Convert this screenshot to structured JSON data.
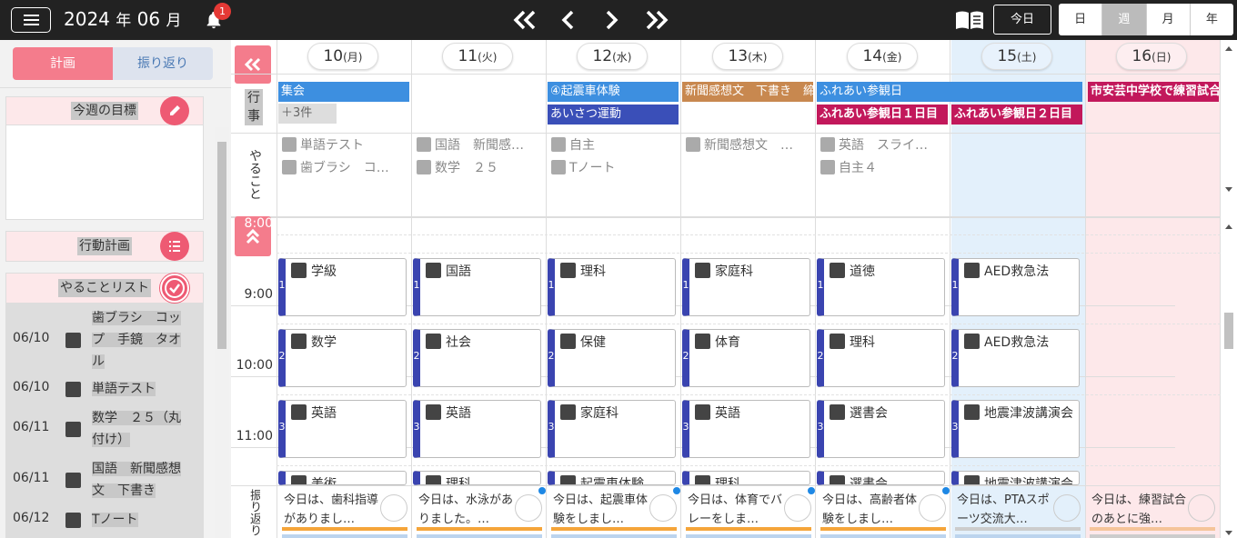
{
  "header": {
    "year": "2024",
    "year_suffix": "年",
    "month": "06",
    "month_suffix": "月",
    "notification_count": "1",
    "today_label": "今日",
    "views": [
      "日",
      "週",
      "月",
      "年"
    ],
    "active_view": "週"
  },
  "sidebar": {
    "tabs": {
      "plan": "計画",
      "review": "振り返り"
    },
    "goal_title": "今週の目標",
    "action_plan_title": "行動計画",
    "todo_title": "やることリスト",
    "todos": [
      {
        "date": "06/10",
        "text": "歯ブラシ　コップ　手鏡　タオル"
      },
      {
        "date": "06/10",
        "text": "単語テスト"
      },
      {
        "date": "06/11",
        "text": "数学　２５（丸付け）"
      },
      {
        "date": "06/11",
        "text": "国語　新聞感想文　下書き"
      },
      {
        "date": "06/12",
        "text": "Tノート"
      }
    ]
  },
  "days": [
    {
      "num": "10",
      "dow": "(月)"
    },
    {
      "num": "11",
      "dow": "(火)"
    },
    {
      "num": "12",
      "dow": "(水)"
    },
    {
      "num": "13",
      "dow": "(木)"
    },
    {
      "num": "14",
      "dow": "(金)"
    },
    {
      "num": "15",
      "dow": "(土)"
    },
    {
      "num": "16",
      "dow": "(日)"
    }
  ],
  "row_labels": {
    "events_1": "行",
    "events_2": "事",
    "todo": "やること",
    "review": "振り返り"
  },
  "events": [
    {
      "text": "集会",
      "color": "#3d8fe0"
    },
    {
      "text": "＋3件",
      "color": "#ddd"
    },
    {
      "text": "④起震車体験",
      "color": "#3d8fe0"
    },
    {
      "text": "あいさつ運動",
      "color": "#3a4fb8"
    },
    {
      "text": "新聞感想文　下書き　締",
      "color": "#c8884f"
    },
    {
      "text": "ふれあい参観日",
      "color": "#3d8fe0"
    },
    {
      "text": "ふれあい参観日１日目",
      "color": "#c2185b"
    },
    {
      "text": "ふれあい参観日２日目",
      "color": "#c2185b"
    },
    {
      "text": "市安芸中学校で練習試合",
      "color": "#c2185b"
    }
  ],
  "day_todos": [
    [
      "単語テスト",
      "歯ブラシ　コ…"
    ],
    [
      "国語　新聞感…",
      "数学　２５"
    ],
    [
      "自主",
      "Tノート"
    ],
    [
      "新聞感想文　…"
    ],
    [
      "英語　スライ…",
      "自主４"
    ],
    [],
    []
  ],
  "times": [
    "8:00",
    "9:00",
    "10:00",
    "11:00"
  ],
  "periods": [
    [
      "学級",
      "数学",
      "英語",
      "美術"
    ],
    [
      "国語",
      "社会",
      "英語",
      "理科"
    ],
    [
      "理科",
      "保健",
      "家庭科",
      "起震車体験"
    ],
    [
      "家庭科",
      "体育",
      "英語",
      "理科"
    ],
    [
      "道徳",
      "理科",
      "選書会",
      "選書会"
    ],
    [
      "AED救急法",
      "AED救急法",
      "地震津波講演会",
      "地震津波講演会"
    ]
  ],
  "reviews": [
    "今日は、歯科指導がありまし…",
    "今日は、水泳がありました。…",
    "今日は、起震車体験をしまし…",
    "今日は、体育でバレーをしま…",
    "今日は、高齢者体験をしまし…",
    "今日は、PTAスポーツ交流大…",
    "今日は、練習試合のあとに強…"
  ],
  "colors": {
    "accent": "#f47c8c",
    "period_bar": "#3a44b0",
    "saturday_bg": "#e3f0fb",
    "sunday_bg": "#fde8ea"
  }
}
